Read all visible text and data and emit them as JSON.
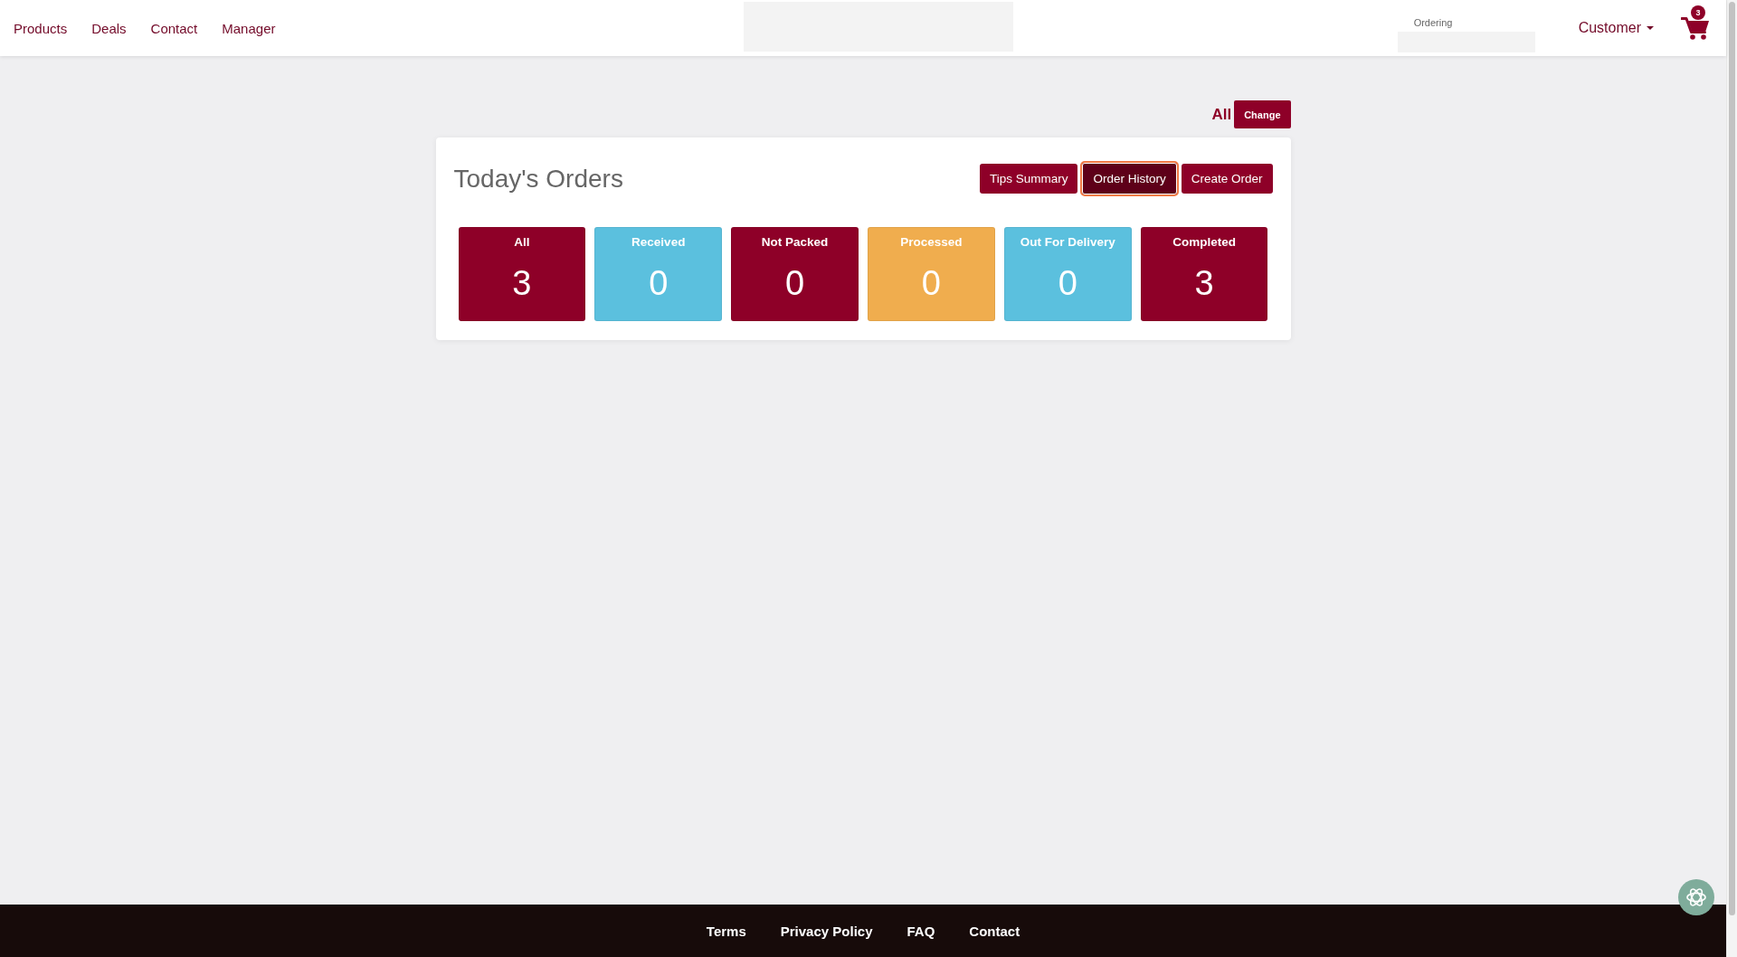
{
  "nav_links": [
    "Products",
    "Deals",
    "Contact",
    "Manager"
  ],
  "ordering_field": {
    "label": "Ordering"
  },
  "user_menu": {
    "label": "Customer"
  },
  "cart": {
    "count": "3"
  },
  "filter": {
    "value": "All",
    "button": "Change"
  },
  "orders_panel": {
    "title": "Today's Orders",
    "buttons": [
      {
        "label": "Tips Summary",
        "focused": false
      },
      {
        "label": "Order History",
        "focused": true
      },
      {
        "label": "Create Order",
        "focused": false
      }
    ],
    "tiles": [
      {
        "label": "All",
        "count": "3",
        "color": "#8e0028"
      },
      {
        "label": "Received",
        "count": "0",
        "color": "#5bc0de"
      },
      {
        "label": "Not Packed",
        "count": "0",
        "color": "#8e0028"
      },
      {
        "label": "Processed",
        "count": "0",
        "color": "#f0ad4e"
      },
      {
        "label": "Out For Delivery",
        "count": "0",
        "color": "#5bc0de"
      },
      {
        "label": "Completed",
        "count": "3",
        "color": "#8e0028"
      }
    ]
  },
  "footer_links": [
    "Terms",
    "Privacy Policy",
    "FAQ",
    "Contact"
  ]
}
